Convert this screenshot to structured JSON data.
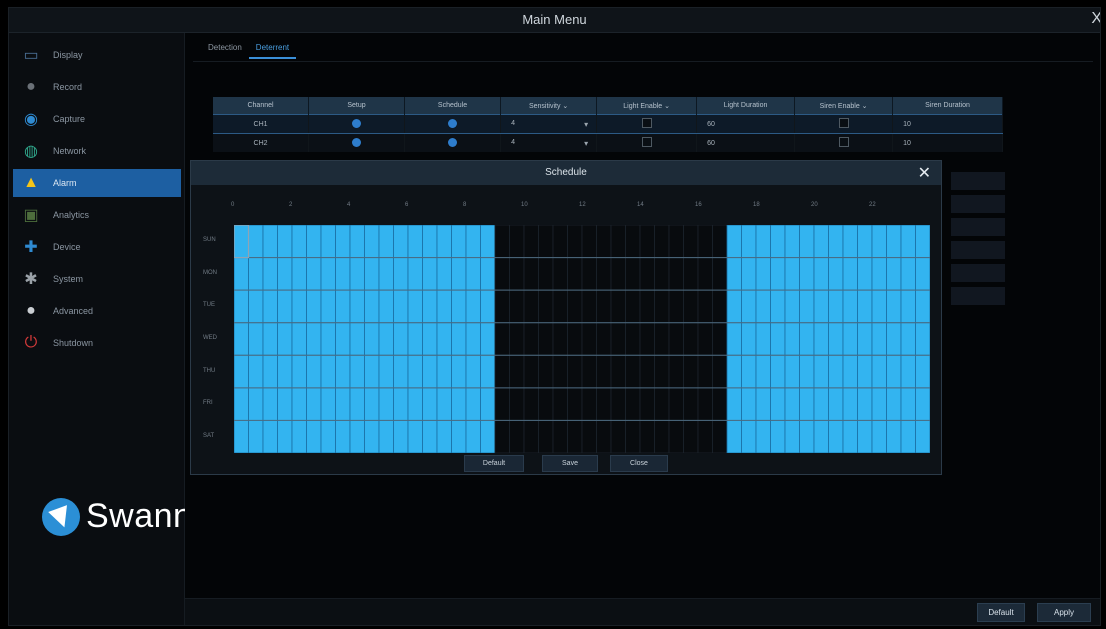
{
  "window": {
    "title": "Main Menu",
    "close_glyph": "X"
  },
  "sidebar": {
    "items": [
      {
        "label": "Display",
        "icon": "display-icon",
        "color": "#4a6e94",
        "active": false
      },
      {
        "label": "Record",
        "icon": "record-icon",
        "color": "#6a7077",
        "active": false
      },
      {
        "label": "Capture",
        "icon": "capture-icon",
        "color": "#2f8ad1",
        "active": false
      },
      {
        "label": "Network",
        "icon": "network-icon",
        "color": "#2fa58a",
        "active": false
      },
      {
        "label": "Alarm",
        "icon": "alarm-icon",
        "color": "#f5c518",
        "active": true
      },
      {
        "label": "Analytics",
        "icon": "analytics-icon",
        "color": "#4d6d3c",
        "active": false
      },
      {
        "label": "Device",
        "icon": "device-icon",
        "color": "#2f8ad1",
        "active": false
      },
      {
        "label": "System",
        "icon": "system-icon",
        "color": "#9aa1a8",
        "active": false
      },
      {
        "label": "Advanced",
        "icon": "advanced-icon",
        "color": "#c9cdd2",
        "active": false
      },
      {
        "label": "Shutdown",
        "icon": "shutdown-icon",
        "color": "#d43a3a",
        "active": false
      }
    ],
    "logo_text": "Swann"
  },
  "tabs": [
    {
      "label": "Detection",
      "active": false
    },
    {
      "label": "Deterrent",
      "active": true
    }
  ],
  "table": {
    "columns": [
      "Channel",
      "Setup",
      "Schedule",
      "Sensitivity",
      "Light Enable",
      "Light Duration",
      "Siren Enable",
      "Siren Duration"
    ],
    "rows": [
      {
        "channel": "CH1",
        "sensitivity": "4",
        "light_duration": "60",
        "siren_duration": "10",
        "selected": true
      },
      {
        "channel": "CH2",
        "sensitivity": "4",
        "light_duration": "60",
        "siren_duration": "10",
        "selected": false
      }
    ]
  },
  "footer": {
    "default_label": "Default",
    "apply_label": "Apply"
  },
  "schedule": {
    "title": "Schedule",
    "close_glyph": "✕",
    "hours": [
      "0",
      "2",
      "4",
      "6",
      "8",
      "10",
      "12",
      "14",
      "16",
      "18",
      "20",
      "22"
    ],
    "days": [
      "SUN",
      "MON",
      "TUE",
      "WED",
      "THU",
      "FRI",
      "SAT"
    ],
    "active_hours": [
      0,
      1,
      2,
      3,
      4,
      5,
      6,
      7,
      8,
      17,
      18,
      19,
      20,
      21,
      22,
      23
    ],
    "active_color": "#33b4f0",
    "buttons": {
      "default": "Default",
      "save": "Save",
      "close": "Close"
    }
  }
}
